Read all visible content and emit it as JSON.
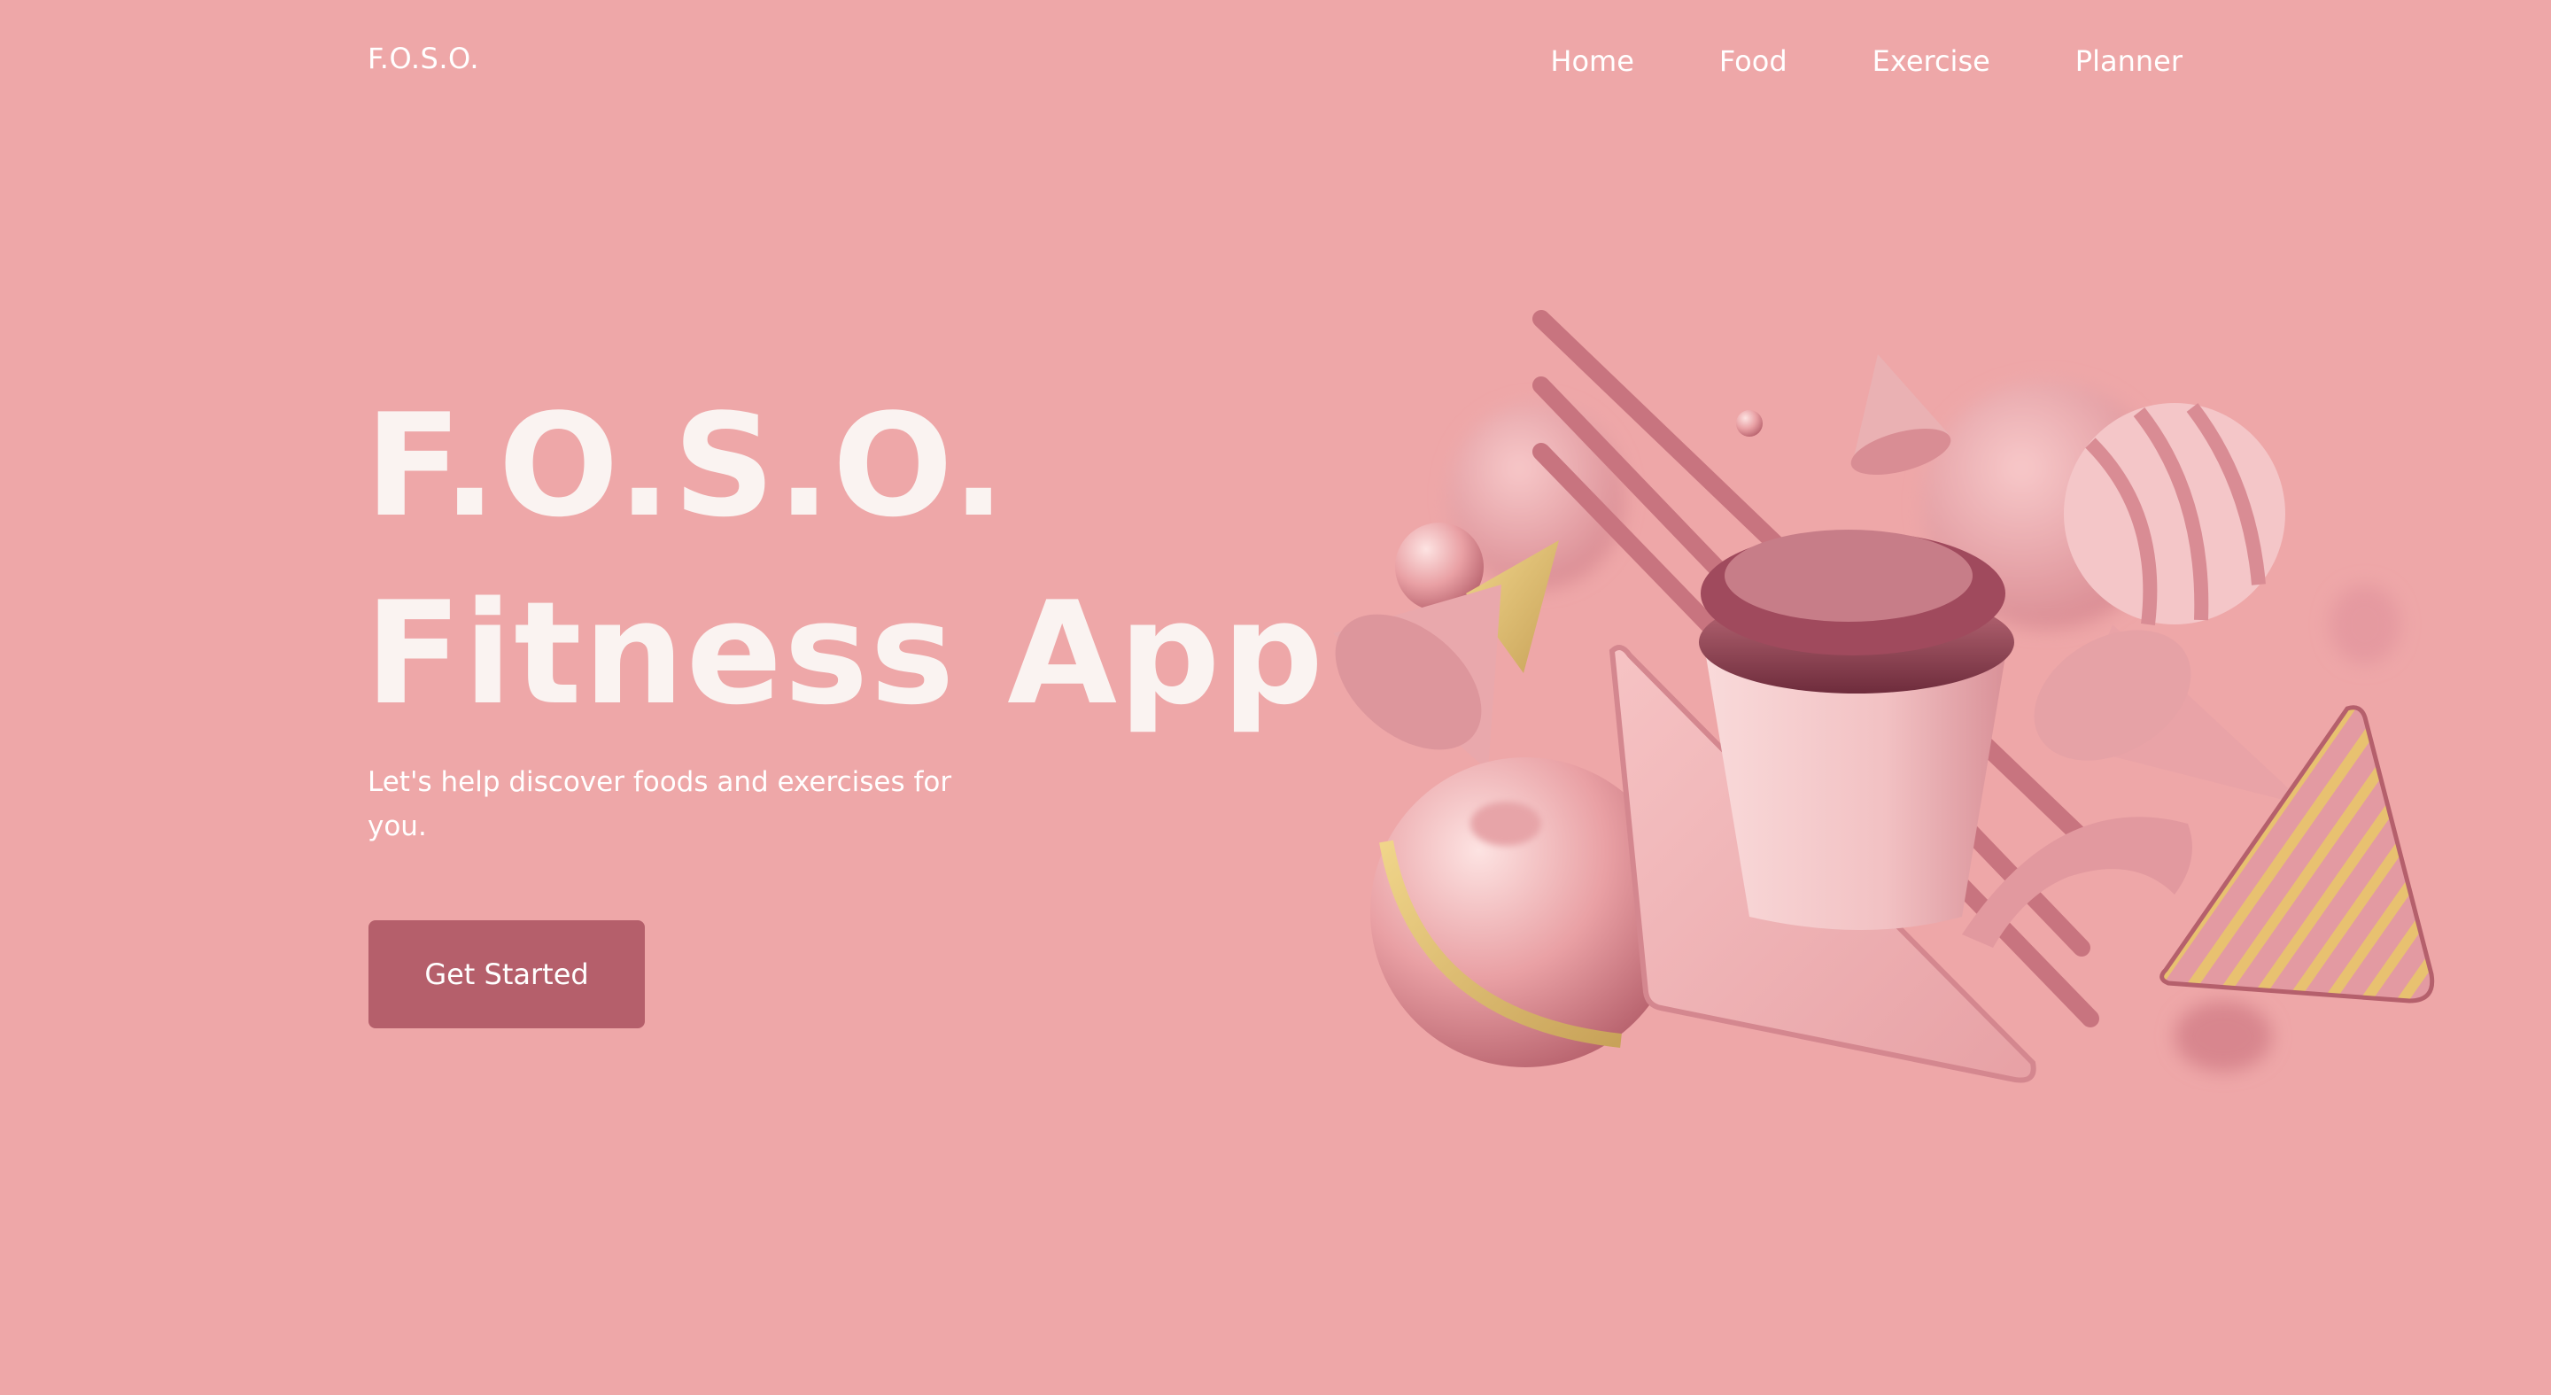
{
  "brand": {
    "name": "F.O.S.O."
  },
  "nav": {
    "items": [
      {
        "label": "Home"
      },
      {
        "label": "Food"
      },
      {
        "label": "Exercise"
      },
      {
        "label": "Planner"
      }
    ]
  },
  "hero": {
    "title_line1": "F.O.S.O.",
    "title_line2": "Fitness App",
    "subtitle": "Let's help discover foods and exercises for you.",
    "cta_label": "Get Started"
  },
  "colors": {
    "background": "#eea7a8",
    "accent": "#b55f6b",
    "text": "#ffffff"
  }
}
